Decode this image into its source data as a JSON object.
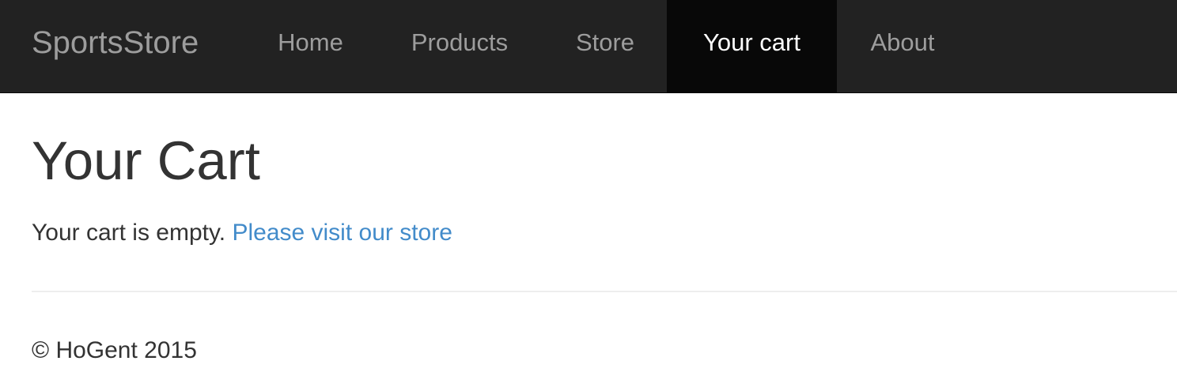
{
  "navbar": {
    "brand": "SportsStore",
    "items": [
      {
        "label": "Home",
        "active": false
      },
      {
        "label": "Products",
        "active": false
      },
      {
        "label": "Store",
        "active": false
      },
      {
        "label": "Your cart",
        "active": true
      },
      {
        "label": "About",
        "active": false
      }
    ],
    "colors": {
      "background": "#222222",
      "text": "#9d9d9d",
      "active_background": "#080808",
      "active_text": "#ffffff"
    }
  },
  "main": {
    "title": "Your Cart",
    "empty_text": "Your cart is empty.",
    "store_link": "Please visit our store",
    "link_color": "#428bca"
  },
  "footer": {
    "text": "© HoGent 2015"
  }
}
